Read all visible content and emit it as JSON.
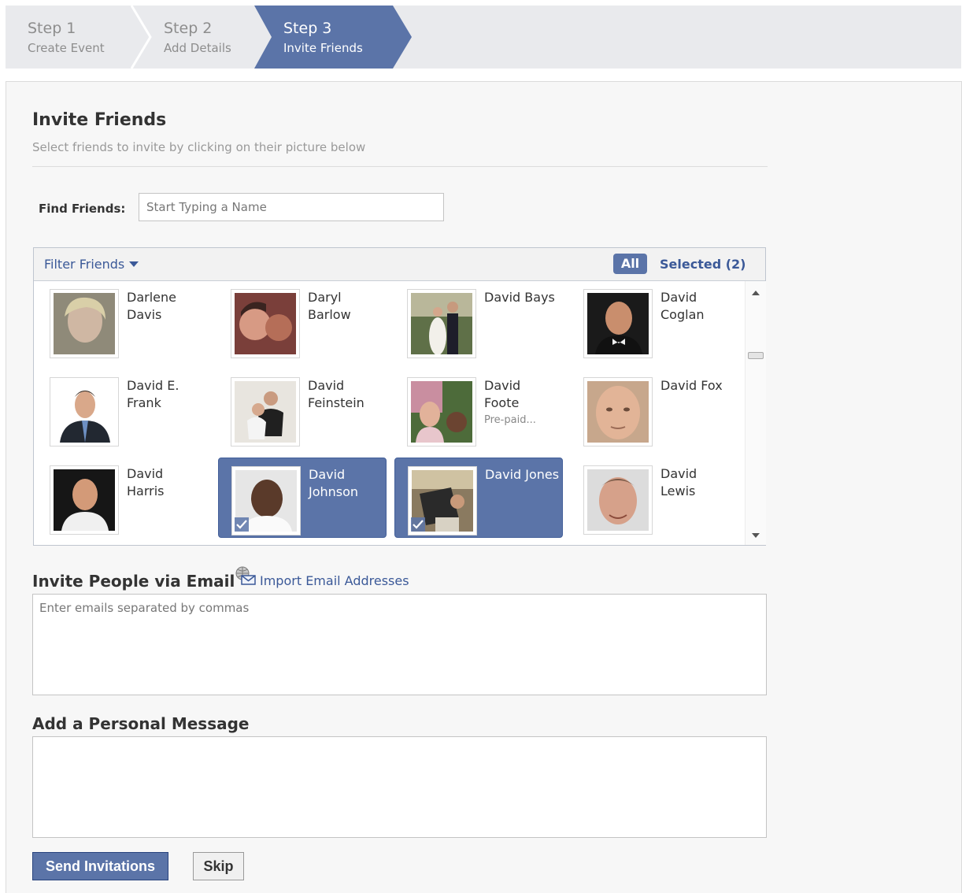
{
  "steps": [
    {
      "number": "Step 1",
      "label": "Create Event"
    },
    {
      "number": "Step 2",
      "label": "Add Details"
    },
    {
      "number": "Step 3",
      "label": "Invite Friends"
    }
  ],
  "invite": {
    "title": "Invite Friends",
    "subtitle": "Select friends to invite by clicking on their picture below"
  },
  "find": {
    "label": "Find Friends:",
    "placeholder": "Start Typing a Name"
  },
  "selector": {
    "filter_label": "Filter Friends",
    "tab_all": "All",
    "tab_selected": "Selected (2)",
    "friends": [
      {
        "name": "Darlene Davis",
        "note": "",
        "selected": false
      },
      {
        "name": "Daryl Barlow",
        "note": "",
        "selected": false
      },
      {
        "name": "David Bays",
        "note": "",
        "selected": false
      },
      {
        "name": "David Coglan",
        "note": "",
        "selected": false
      },
      {
        "name": "David E. Frank",
        "note": "",
        "selected": false
      },
      {
        "name": "David Feinstein",
        "note": "",
        "selected": false
      },
      {
        "name": "David Foote",
        "note": "Pre-paid...",
        "selected": false
      },
      {
        "name": "David Fox",
        "note": "",
        "selected": false
      },
      {
        "name": "David Harris",
        "note": "",
        "selected": false
      },
      {
        "name": "David Johnson",
        "note": "",
        "selected": true
      },
      {
        "name": "David Jones",
        "note": "",
        "selected": true
      },
      {
        "name": "David Lewis",
        "note": "",
        "selected": false
      }
    ]
  },
  "email": {
    "title": "Invite People via Email",
    "import_label": "Import Email Addresses",
    "placeholder": "Enter emails separated by commas"
  },
  "message": {
    "title": "Add a Personal Message"
  },
  "buttons": {
    "send": "Send Invitations",
    "skip": "Skip"
  },
  "colors": {
    "accent": "#5b74a8",
    "link": "#3b5998",
    "stepbar": "#e9eaed"
  }
}
